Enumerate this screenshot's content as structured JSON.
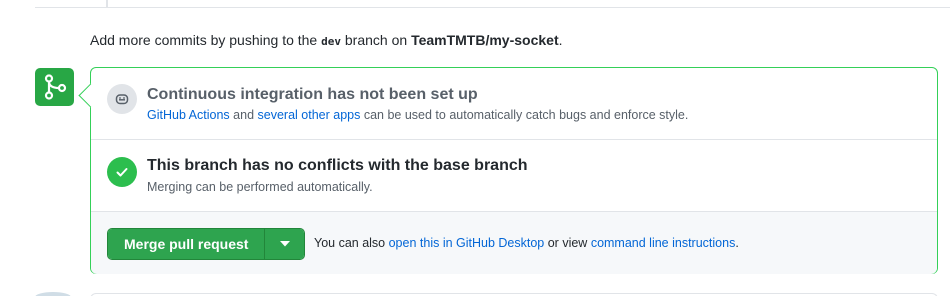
{
  "push_note": {
    "prefix": "Add more commits by pushing to the",
    "branch": "dev",
    "middle": "branch on",
    "repo": "TeamTMTB/my-socket",
    "suffix": "."
  },
  "ci": {
    "title": "Continuous integration has not been set up",
    "link1": "GitHub Actions",
    "and": "and",
    "link2": "several other apps",
    "rest": "can be used to automatically catch bugs and enforce style."
  },
  "conflicts": {
    "title": "This branch has no conflicts with the base branch",
    "subtitle": "Merging can be performed automatically."
  },
  "merge": {
    "button_label": "Merge pull request",
    "also_text": "You can also",
    "desktop_link": "open this in GitHub Desktop",
    "or_view": "or view",
    "cli_link": "command line instructions",
    "end": "."
  },
  "colors": {
    "accent_green": "#28a745",
    "link_blue": "#0366d6",
    "border_green": "#34d058"
  },
  "icons": [
    "git-merge-icon",
    "robot-icon",
    "check-icon",
    "caret-down-icon"
  ]
}
